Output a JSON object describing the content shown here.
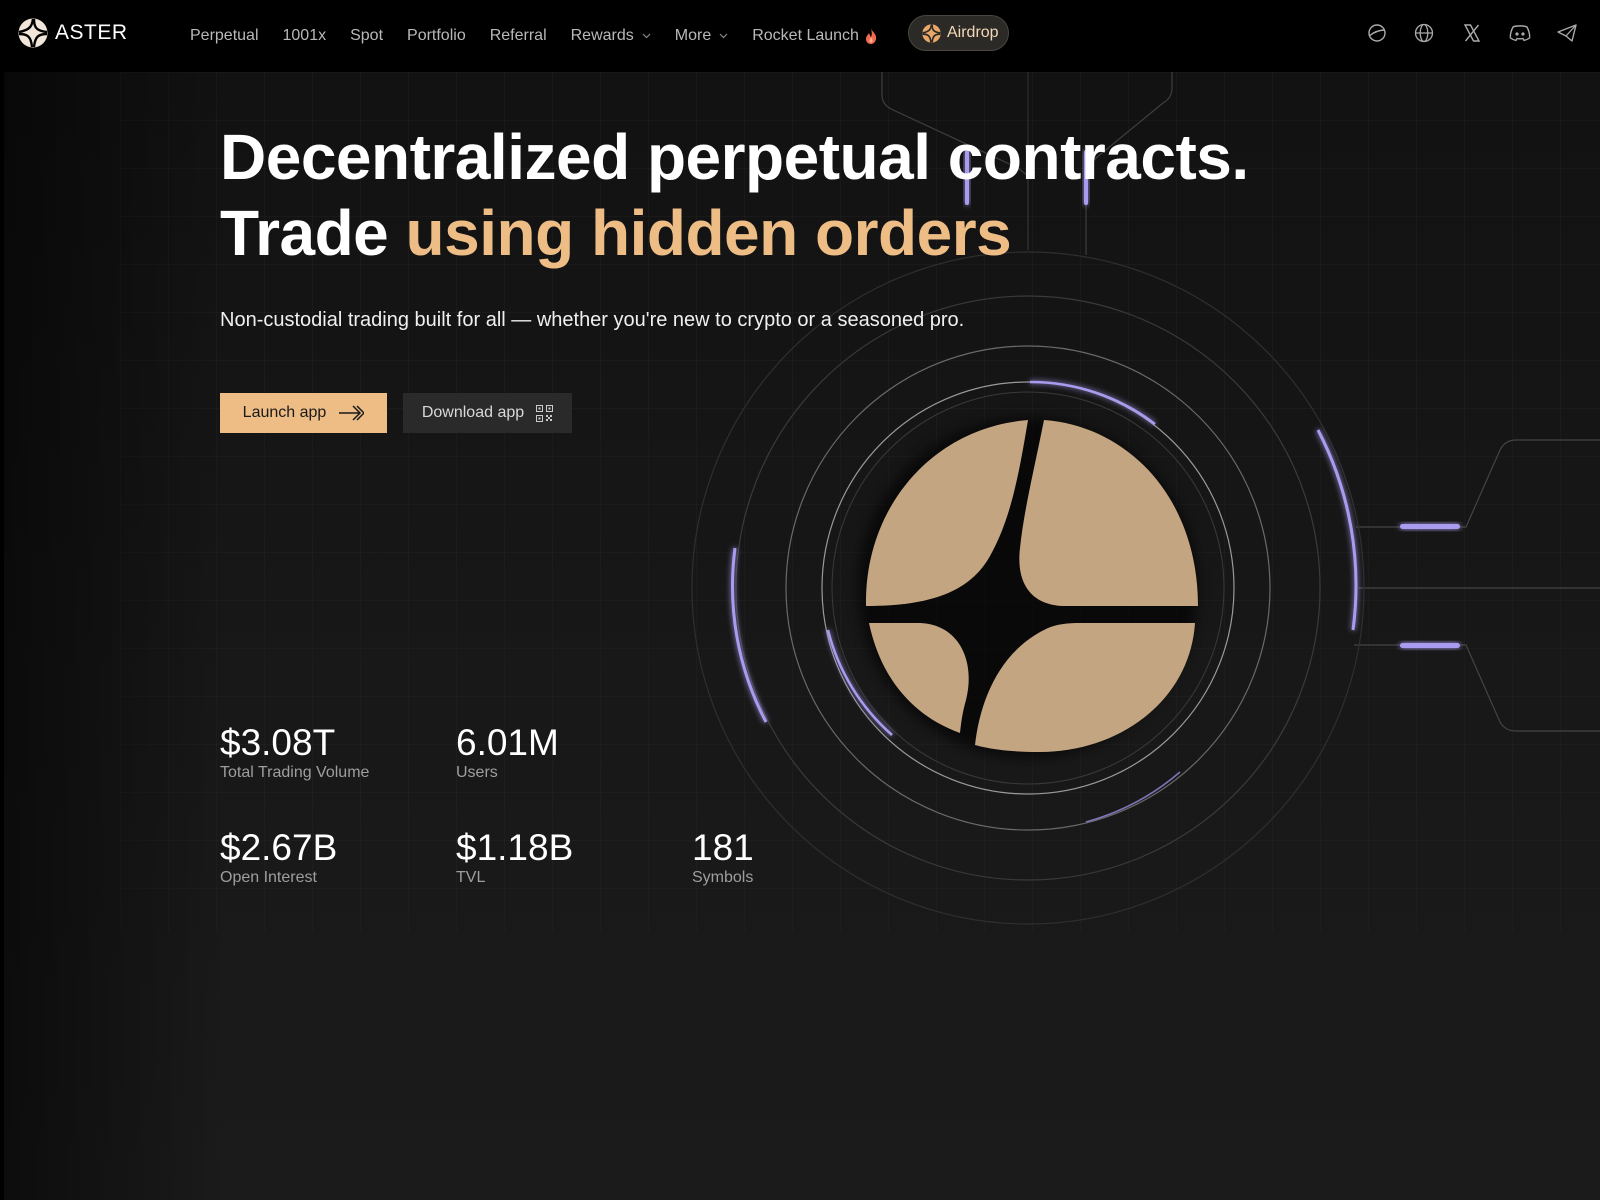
{
  "brand": {
    "name": "ASTER"
  },
  "nav": {
    "links": [
      {
        "label": "Perpetual"
      },
      {
        "label": "1001x"
      },
      {
        "label": "Spot"
      },
      {
        "label": "Portfolio"
      },
      {
        "label": "Referral"
      },
      {
        "label": "Rewards",
        "has_dropdown": true
      },
      {
        "label": "More",
        "has_dropdown": true
      },
      {
        "label": "Rocket Launch",
        "badge_icon": "flame-icon"
      }
    ],
    "airdrop": {
      "label": "Airdrop",
      "icon": "aster-logo-icon"
    },
    "social_icons": [
      "planet-icon",
      "globe-icon",
      "x-icon",
      "discord-icon",
      "telegram-icon"
    ]
  },
  "hero": {
    "title_line1": "Decentralized perpetual contracts.",
    "title_line2_prefix": "Trade",
    "title_line2_accent": "using hidden orders",
    "subtitle": "Non-custodial trading built for all — whether you're new to crypto or a seasoned pro.",
    "launch_label": "Launch app",
    "download_label": "Download app"
  },
  "stats": [
    {
      "value": "$3.08T",
      "label": "Total Trading Volume"
    },
    {
      "value": "6.01M",
      "label": "Users"
    },
    {
      "value": "$2.67B",
      "label": "Open Interest"
    },
    {
      "value": "$1.18B",
      "label": "TVL"
    },
    {
      "value": "181",
      "label": "Symbols"
    }
  ],
  "colors": {
    "accent": "#eebd85",
    "logo_fill": "#c4a582",
    "glow": "#a99cf0",
    "background": "#1a1a1a",
    "nav_background": "#000000"
  }
}
